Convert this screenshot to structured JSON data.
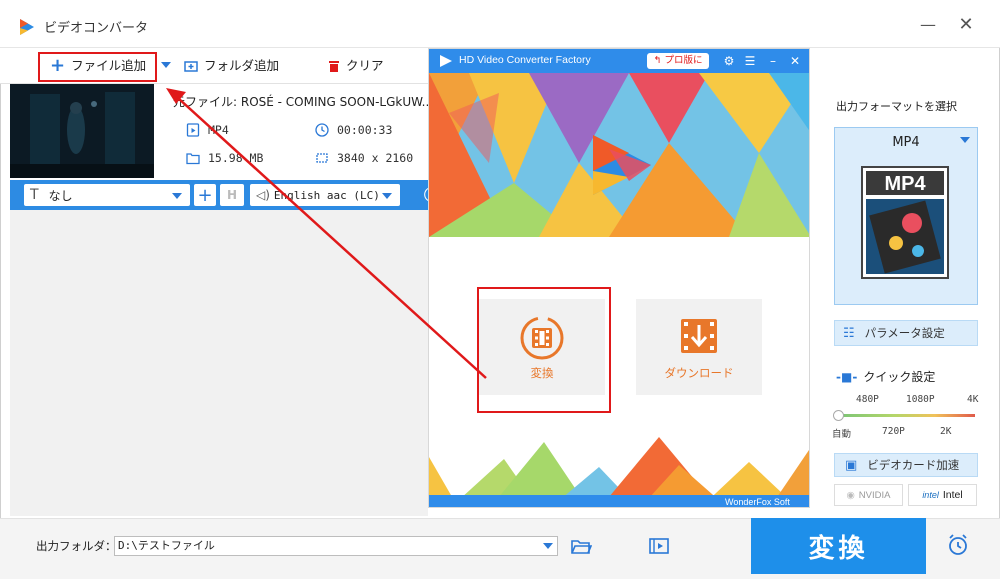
{
  "window": {
    "title": "ビデオコンバータ",
    "minimize": "—",
    "close": "✕"
  },
  "toolbar": {
    "add_file": "ファイル追加",
    "add_folder": "フォルダ追加",
    "clear": "クリア"
  },
  "file": {
    "name": "元ファイル: ROSÉ - COMING SOON-LGkUW...",
    "format": "MP4",
    "duration": "00:00:33",
    "size": "15.98 MB",
    "resolution": "3840 x 2160"
  },
  "tracks": {
    "subtitle": "なし",
    "audio": "English aac (LC)"
  },
  "popup": {
    "title": "HD Video Converter Factory",
    "pro_button": "プロ版に",
    "convert_label": "変換",
    "download_label": "ダウンロード",
    "brand": "WonderFox Soft"
  },
  "right_panel": {
    "title": "出力フォーマットを選択",
    "format": "MP4",
    "format_image_text": "MP4",
    "param_button": "パラメータ設定",
    "quick_title": "クイック設定",
    "quality_top": [
      "480P",
      "1080P",
      "4K"
    ],
    "quality_bottom": [
      "自動",
      "720P",
      "2K"
    ],
    "gpu_button": "ビデオカード加速",
    "nvidia": "NVIDIA",
    "intel": "Intel"
  },
  "bottom": {
    "output_label": "出力フォルダ：",
    "output_path": "D:\\テストファイル",
    "run_button": "変換"
  },
  "colors": {
    "accent": "#2d8be3",
    "highlight_red": "#e0191a",
    "tile_orange": "#e8772a"
  }
}
